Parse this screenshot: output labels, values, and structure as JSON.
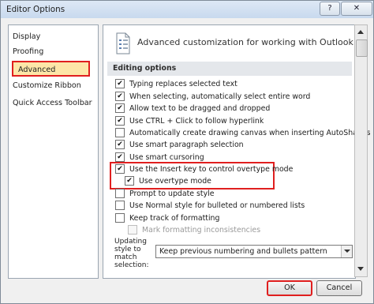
{
  "window": {
    "title": "Editor Options",
    "help_glyph": "?",
    "close_glyph": "✕"
  },
  "sidebar": {
    "items": [
      {
        "label": "Display"
      },
      {
        "label": "Proofing"
      },
      {
        "label": "Advanced"
      },
      {
        "label": "Customize Ribbon"
      },
      {
        "label": "Quick Access Toolbar"
      }
    ]
  },
  "header": {
    "title": "Advanced customization for working with Outlook"
  },
  "section": {
    "title": "Editing options"
  },
  "options": [
    {
      "label": "Typing replaces selected text",
      "checked": true
    },
    {
      "label": "When selecting, automatically select entire word",
      "checked": true
    },
    {
      "label": "Allow text to be dragged and dropped",
      "checked": true
    },
    {
      "label": "Use CTRL + Click to follow hyperlink",
      "checked": true
    },
    {
      "label": "Automatically create drawing canvas when inserting AutoShapes",
      "checked": false
    },
    {
      "label": "Use smart paragraph selection",
      "checked": true
    },
    {
      "label": "Use smart cursoring",
      "checked": true
    },
    {
      "label": "Use the Insert key to control overtype mode",
      "checked": true
    },
    {
      "label": "Use overtype mode",
      "checked": true
    },
    {
      "label": "Prompt to update style",
      "checked": false
    },
    {
      "label": "Use Normal style for bulleted or numbered lists",
      "checked": false
    },
    {
      "label": "Keep track of formatting",
      "checked": false
    },
    {
      "label": "Mark formatting inconsistencies",
      "checked": false,
      "disabled": true
    }
  ],
  "updating_style": {
    "label_lines": [
      "Updating",
      "style to",
      "match",
      "selection:"
    ],
    "value": "Keep previous numbering and bullets pattern"
  },
  "buttons": {
    "ok": "OK",
    "cancel": "Cancel"
  },
  "check_glyph": "✔"
}
